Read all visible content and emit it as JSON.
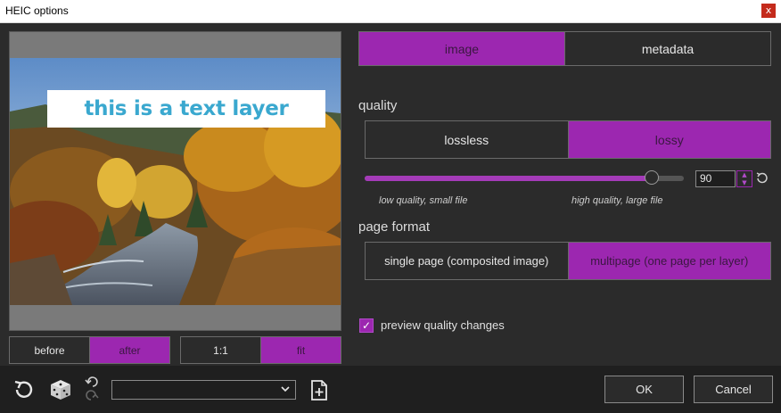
{
  "window": {
    "title": "HEIC options",
    "close_glyph": "x"
  },
  "preview": {
    "text_layer": "this is a text layer",
    "before_after": [
      {
        "label": "before",
        "active": false
      },
      {
        "label": "after",
        "active": true
      }
    ],
    "zoom": [
      {
        "label": "1:1",
        "active": false
      },
      {
        "label": "fit",
        "active": true
      }
    ]
  },
  "tabs": [
    {
      "label": "image",
      "active": true
    },
    {
      "label": "metadata",
      "active": false
    }
  ],
  "quality": {
    "label": "quality",
    "modes": [
      {
        "label": "lossless",
        "active": false
      },
      {
        "label": "lossy",
        "active": true
      }
    ],
    "slider_value": 90,
    "value_text": "90",
    "low_hint": "low quality, small file",
    "high_hint": "high quality, large file"
  },
  "page_format": {
    "label": "page format",
    "options": [
      {
        "label": "single page (composited image)",
        "active": false
      },
      {
        "label": "multipage (one page per layer)",
        "active": true
      }
    ]
  },
  "preview_quality_changes": {
    "label": "preview quality changes",
    "checked": true
  },
  "toolbar": {
    "icons": [
      "reset-icon",
      "dice-icon",
      "undo-icon",
      "redo-icon",
      "add-preset-icon"
    ],
    "preset_value": ""
  },
  "actions": {
    "ok": "OK",
    "cancel": "Cancel"
  },
  "colors": {
    "accent": "#9c27b0",
    "background": "#2b2b2b",
    "toolbar": "#1f1f1f"
  }
}
